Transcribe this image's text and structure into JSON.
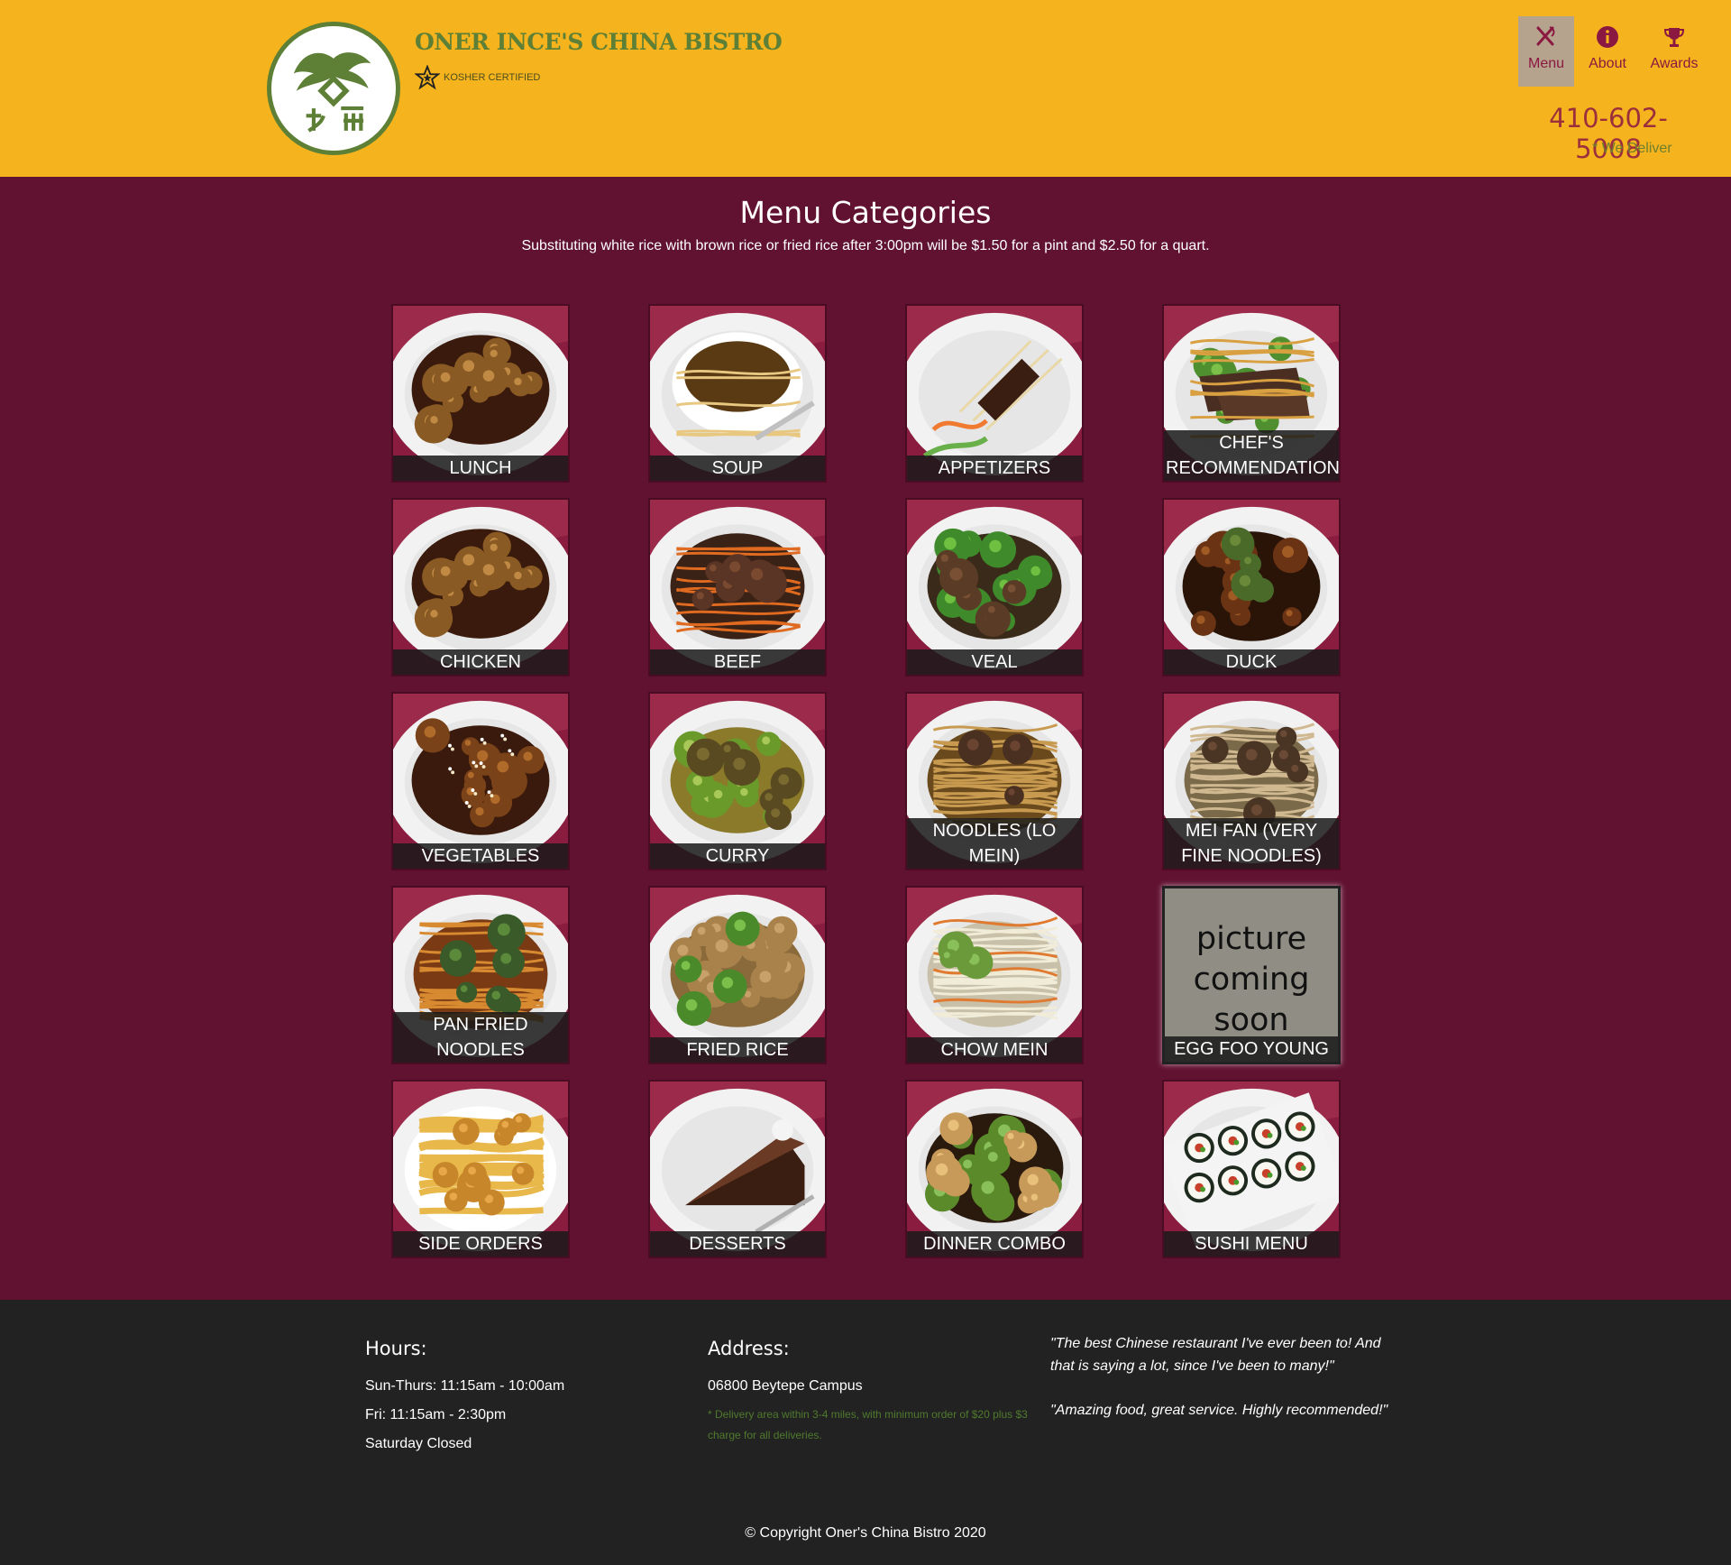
{
  "header": {
    "brand_title": "ONER INCE'S CHINA BISTRO",
    "kosher_label": "KOSHER CERTIFIED",
    "logo_icon": "dragon-logo-icon",
    "nav": [
      {
        "label": "Menu",
        "icon": "fork-knife-icon",
        "active": true
      },
      {
        "label": "About",
        "icon": "info-icon",
        "active": false
      },
      {
        "label": "Awards",
        "icon": "trophy-icon",
        "active": false
      }
    ],
    "phone": "410-602-5008",
    "deliver_note": "* We Deliver"
  },
  "main": {
    "title": "Menu Categories",
    "note": "Substituting white rice with brown rice or fried rice after 3:00pm will be $1.50 for a pint and $2.50 for a quart.",
    "categories": [
      {
        "label": "LUNCH",
        "dish": "orange-chicken"
      },
      {
        "label": "SOUP",
        "dish": "soup"
      },
      {
        "label": "APPETIZERS",
        "dish": "skewers"
      },
      {
        "label": "CHEF'S RECOMMENDATIONS",
        "dish": "steak"
      },
      {
        "label": "CHICKEN",
        "dish": "orange-chicken"
      },
      {
        "label": "BEEF",
        "dish": "beef"
      },
      {
        "label": "VEAL",
        "dish": "veal"
      },
      {
        "label": "DUCK",
        "dish": "duck"
      },
      {
        "label": "VEGETABLES",
        "dish": "sesame"
      },
      {
        "label": "CURRY",
        "dish": "curry"
      },
      {
        "label": "NOODLES (LO MEIN)",
        "dish": "lomein"
      },
      {
        "label": "MEI FAN (VERY FINE NOODLES)",
        "dish": "meifan"
      },
      {
        "label": "PAN FRIED NOODLES",
        "dish": "panfried"
      },
      {
        "label": "FRIED RICE",
        "dish": "friedrice"
      },
      {
        "label": "CHOW MEIN",
        "dish": "chowmein"
      },
      {
        "label": "EGG FOO YOUNG",
        "dish": "placeholder",
        "placeholder_text": "picture coming soon"
      },
      {
        "label": "SIDE ORDERS",
        "dish": "fries"
      },
      {
        "label": "DESSERTS",
        "dish": "cake"
      },
      {
        "label": "DINNER COMBO",
        "dish": "kungpao"
      },
      {
        "label": "SUSHI MENU",
        "dish": "sushi"
      }
    ]
  },
  "footer": {
    "hours_title": "Hours:",
    "hours": [
      "Sun-Thurs: 11:15am - 10:00am",
      "Fri: 11:15am - 2:30pm",
      "Saturday Closed"
    ],
    "address_title": "Address:",
    "address": "06800 Beytepe Campus",
    "delivery_note": "* Delivery area within 3-4 miles, with minimum order of $20 plus $3 charge for all deliveries.",
    "quotes": [
      "\"The best Chinese restaurant I've ever been to! And that is saying a lot, since I've been to many!\"",
      "\"Amazing food, great service. Highly recommended!\""
    ],
    "copyright": "© Copyright Oner's China Bistro 2020"
  },
  "colors": {
    "header_bg": "#f5b41d",
    "main_bg": "#611230",
    "footer_bg": "#222222",
    "brand_green": "#5d7f36",
    "accent_red": "#8b1840"
  }
}
